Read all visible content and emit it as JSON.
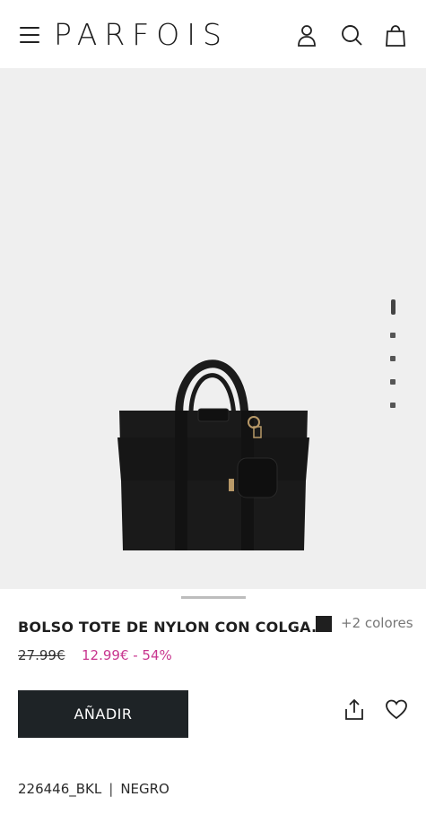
{
  "header": {
    "logo": "PARFOIS",
    "icons": [
      "menu-icon",
      "user-icon",
      "search-icon",
      "bag-icon"
    ]
  },
  "gallery": {
    "pages": 5,
    "active_page": 1,
    "background_color": "#efefef"
  },
  "product": {
    "title": "BOLSO TOTE DE NYLON CON COLGA...",
    "colors_label": "+2 colores",
    "selected_color": "#1f1f1f",
    "old_price": "27.99€",
    "new_price": "12.99€ - 54%",
    "add_label": "AÑADIR",
    "reference": "226446_BKL",
    "separator": "|",
    "color_name": "NEGRO"
  },
  "colors": {
    "accent": "#c8368f",
    "button": "#1e2326"
  }
}
